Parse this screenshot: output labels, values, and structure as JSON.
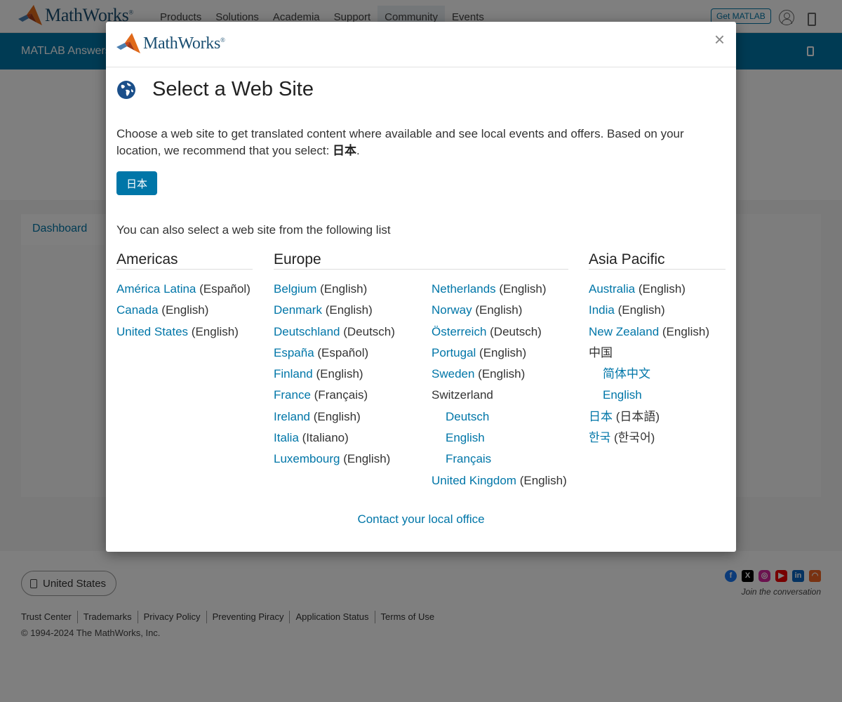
{
  "colors": {
    "brand_blue": "#0076a8",
    "link": "#0076a8",
    "overlay": "rgba(0,0,0,0.5)"
  },
  "page": {
    "logo_text": "MathWorks",
    "logo_mark": "®",
    "nav": [
      "Products",
      "Solutions",
      "Academia",
      "Support",
      "Community",
      "Events"
    ],
    "get_matlab": "Get MATLAB",
    "subbar_title": "MATLAB Answers",
    "dashboard_tab": "Dashboard",
    "locale_button": "United States",
    "join_text": "Join the conversation",
    "social_icons": [
      "facebook-icon",
      "x-icon",
      "instagram-icon",
      "youtube-icon",
      "linkedin-icon",
      "rss-icon"
    ],
    "footer_links": [
      "Trust Center",
      "Trademarks",
      "Privacy Policy",
      "Preventing Piracy",
      "Application Status",
      "Terms of Use"
    ],
    "copyright": "© 1994-2024 The MathWorks, Inc."
  },
  "modal": {
    "logo_text": "MathWorks",
    "logo_mark": "®",
    "close": "×",
    "title": "Select a Web Site",
    "intro": "Choose a web site to get translated content where available and see local events and offers. Based on your location, we recommend that you select: ",
    "recommended": "日本",
    "intro_end": ".",
    "recommended_button": "日本",
    "list_intro": "You can also select a web site from the following list",
    "regions": {
      "americas": "Americas",
      "europe": "Europe",
      "asia_pacific": "Asia Pacific"
    },
    "americas": [
      {
        "link": "América Latina",
        "lang": " (Español)"
      },
      {
        "link": "Canada",
        "lang": " (English)"
      },
      {
        "link": "United States",
        "lang": " (English)"
      }
    ],
    "europe_col1": [
      {
        "link": "Belgium",
        "lang": " (English)"
      },
      {
        "link": "Denmark",
        "lang": " (English)"
      },
      {
        "link": "Deutschland",
        "lang": " (Deutsch)"
      },
      {
        "link": "España",
        "lang": " (Español)"
      },
      {
        "link": "Finland",
        "lang": " (English)"
      },
      {
        "link": "France",
        "lang": " (Français)"
      },
      {
        "link": "Ireland",
        "lang": " (English)"
      },
      {
        "link": "Italia",
        "lang": " (Italiano)"
      },
      {
        "link": "Luxembourg",
        "lang": " (English)"
      }
    ],
    "europe_col2": [
      {
        "link": "Netherlands",
        "lang": " (English)"
      },
      {
        "link": "Norway",
        "lang": " (English)"
      },
      {
        "link": "Österreich",
        "lang": " (Deutsch)"
      },
      {
        "link": "Portugal",
        "lang": " (English)"
      },
      {
        "link": "Sweden",
        "lang": " (English)"
      },
      {
        "text": "Switzerland"
      },
      {
        "link": "Deutsch",
        "sub": true
      },
      {
        "link": "English",
        "sub": true
      },
      {
        "link": "Français",
        "sub": true
      },
      {
        "link": "United Kingdom",
        "lang": " (English)"
      }
    ],
    "asia_pacific": [
      {
        "link": "Australia",
        "lang": " (English)"
      },
      {
        "link": "India",
        "lang": " (English)"
      },
      {
        "link": "New Zealand",
        "lang": " (English)"
      },
      {
        "text": "中国"
      },
      {
        "link": "简体中文",
        "sub": true
      },
      {
        "link": "English",
        "sub": true
      },
      {
        "link": "日本",
        "lang": " (日本語)"
      },
      {
        "link": "한국",
        "lang": " (한국어)"
      }
    ],
    "contact": "Contact your local office"
  }
}
